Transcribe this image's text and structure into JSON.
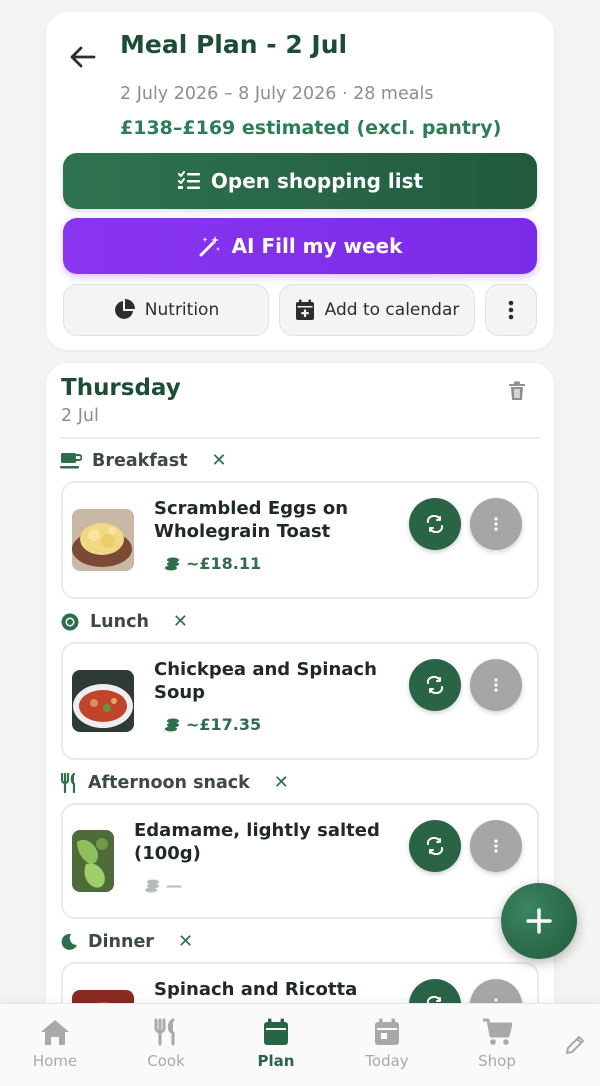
{
  "header": {
    "title": "Meal Plan - 2 Jul",
    "subtitle": "2 July 2026 – 8 July 2026 · 28 meals",
    "estimate": "£138–£169 estimated (excl. pantry)",
    "shopping_label": "Open shopping list",
    "ai_label": "AI Fill my week",
    "nutrition_label": "Nutrition",
    "calendar_label": "Add to calendar"
  },
  "day": {
    "name": "Thursday",
    "date": "2 Jul",
    "meals": [
      {
        "label": "Breakfast",
        "name_line1": "Scrambled Eggs on",
        "name_line2": "Wholegrain Toast",
        "price": "~£18.11"
      },
      {
        "label": "Lunch",
        "name_line1": "Chickpea and Spinach",
        "name_line2": "Soup",
        "price": "~£17.35"
      },
      {
        "label": "Afternoon snack",
        "name_line1": "Edamame, lightly salted",
        "name_line2": "(100g)",
        "price": "—"
      },
      {
        "label": "Dinner",
        "name_line1": "Spinach and Ricotta",
        "name_line2": "",
        "price": ""
      }
    ]
  },
  "nav": {
    "items": [
      "Home",
      "Cook",
      "Plan",
      "Today",
      "Shop"
    ],
    "active": "Plan"
  },
  "colors": {
    "primary_green": "#2a6446",
    "ai_purple": "#7a2be8",
    "accent_text": "#2e7d55"
  },
  "icons": {
    "back": "arrow-left-icon",
    "shopping": "checklist-icon",
    "ai": "magic-wand-icon",
    "nutrition": "pie-chart-icon",
    "calendar": "calendar-add-icon",
    "more": "kebab-icon",
    "trash": "trash-icon",
    "swap": "swap-icon",
    "fab": "plus-icon"
  }
}
